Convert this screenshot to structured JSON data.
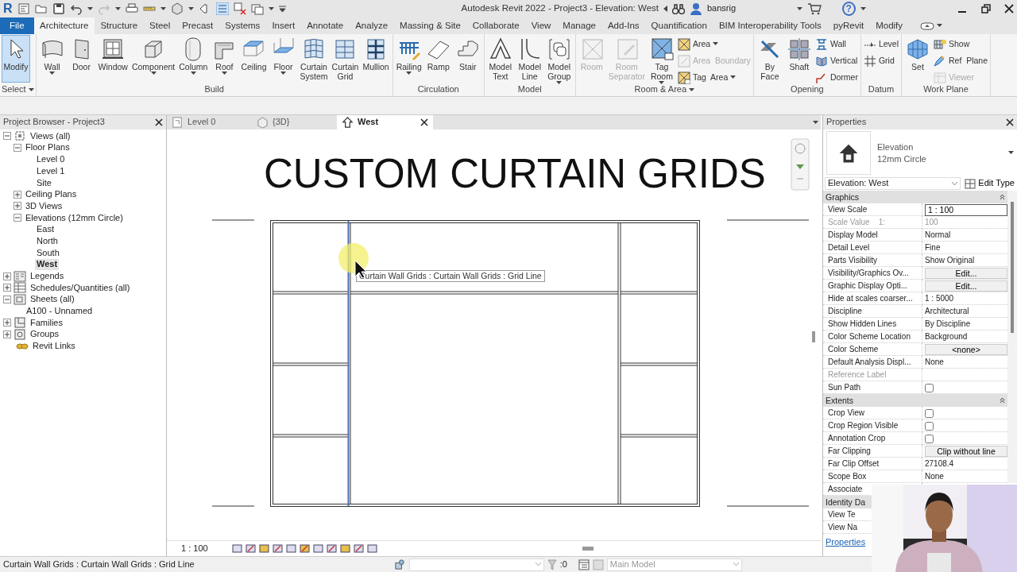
{
  "title_bar": {
    "logo": "R",
    "title": "Autodesk Revit 2022 - Project3 - Elevation: West",
    "user": "bansrig",
    "help": "?"
  },
  "ribbon_tabs": [
    {
      "label": "File",
      "kind": "file",
      "selected": false
    },
    {
      "label": "Architecture",
      "kind": "tab",
      "selected": true
    },
    {
      "label": "Structure",
      "kind": "tab",
      "selected": false
    },
    {
      "label": "Steel",
      "kind": "tab",
      "selected": false
    },
    {
      "label": "Precast",
      "kind": "tab",
      "selected": false
    },
    {
      "label": "Systems",
      "kind": "tab",
      "selected": false
    },
    {
      "label": "Insert",
      "kind": "tab",
      "selected": false
    },
    {
      "label": "Annotate",
      "kind": "tab",
      "selected": false
    },
    {
      "label": "Analyze",
      "kind": "tab",
      "selected": false
    },
    {
      "label": "Massing & Site",
      "kind": "tab",
      "selected": false
    },
    {
      "label": "Collaborate",
      "kind": "tab",
      "selected": false
    },
    {
      "label": "View",
      "kind": "tab",
      "selected": false
    },
    {
      "label": "Manage",
      "kind": "tab",
      "selected": false
    },
    {
      "label": "Add-Ins",
      "kind": "tab",
      "selected": false
    },
    {
      "label": "Quantification",
      "kind": "tab",
      "selected": false
    },
    {
      "label": "BIM Interoperability Tools",
      "kind": "tab",
      "selected": false
    },
    {
      "label": "pyRevit",
      "kind": "tab",
      "selected": false
    },
    {
      "label": "Modify",
      "kind": "tab",
      "selected": false
    }
  ],
  "ribbon_panels": [
    {
      "label": "Select",
      "menu": true,
      "tools": [
        {
          "label": "Modify",
          "kind": "large",
          "selected": true,
          "disabled": false,
          "dropdown": false
        }
      ]
    },
    {
      "label": "Build",
      "menu": false,
      "tools": [
        {
          "label": "Wall",
          "kind": "large",
          "selected": false,
          "disabled": false,
          "dropdown": true
        },
        {
          "label": "Door",
          "kind": "large",
          "selected": false,
          "disabled": false,
          "dropdown": false
        },
        {
          "label": "Window",
          "kind": "large",
          "selected": false,
          "disabled": false,
          "dropdown": false
        },
        {
          "label": "Component",
          "kind": "large",
          "selected": false,
          "disabled": false,
          "dropdown": true
        },
        {
          "label": "Column",
          "kind": "large",
          "selected": false,
          "disabled": false,
          "dropdown": true
        },
        {
          "label": "Roof",
          "kind": "large",
          "selected": false,
          "disabled": false,
          "dropdown": true
        },
        {
          "label": "Ceiling",
          "kind": "large",
          "selected": false,
          "disabled": false,
          "dropdown": false
        },
        {
          "label": "Floor",
          "kind": "large",
          "selected": false,
          "disabled": false,
          "dropdown": true
        },
        {
          "label": "Curtain\nSystem",
          "kind": "large",
          "selected": false,
          "disabled": false,
          "dropdown": false
        },
        {
          "label": "Curtain\nGrid",
          "kind": "large",
          "selected": false,
          "disabled": false,
          "dropdown": false
        },
        {
          "label": "Mullion",
          "kind": "large",
          "selected": false,
          "disabled": false,
          "dropdown": false
        }
      ]
    },
    {
      "label": "Circulation",
      "menu": false,
      "tools": [
        {
          "label": "Railing",
          "kind": "large",
          "selected": false,
          "disabled": false,
          "dropdown": true
        },
        {
          "label": "Ramp",
          "kind": "large",
          "selected": false,
          "disabled": false,
          "dropdown": false
        },
        {
          "label": "Stair",
          "kind": "large",
          "selected": false,
          "disabled": false,
          "dropdown": false
        }
      ]
    },
    {
      "label": "Model",
      "menu": false,
      "tools": [
        {
          "label": "Model\nText",
          "kind": "large",
          "selected": false,
          "disabled": false,
          "dropdown": false
        },
        {
          "label": "Model\nLine",
          "kind": "large",
          "selected": false,
          "disabled": false,
          "dropdown": false
        },
        {
          "label": "Model\nGroup",
          "kind": "large",
          "selected": false,
          "disabled": false,
          "dropdown": true
        }
      ]
    },
    {
      "label": "Room & Area",
      "menu": true,
      "tools": [
        {
          "label": "Room",
          "kind": "large",
          "selected": false,
          "disabled": true,
          "dropdown": false
        },
        {
          "label": "Room\nSeparator",
          "kind": "large",
          "selected": false,
          "disabled": true,
          "dropdown": false
        },
        {
          "label": "Tag\nRoom",
          "kind": "large",
          "selected": false,
          "disabled": false,
          "dropdown": true
        },
        {
          "label": "Area",
          "kind": "small",
          "selected": false,
          "disabled": false,
          "dropdown": true
        },
        {
          "label": "Area  Boundary",
          "kind": "small",
          "selected": false,
          "disabled": true,
          "dropdown": false
        },
        {
          "label": "Tag  Area",
          "kind": "small",
          "selected": false,
          "disabled": false,
          "dropdown": true
        }
      ]
    },
    {
      "label": "Opening",
      "menu": false,
      "tools": [
        {
          "label": "By\nFace",
          "kind": "large",
          "selected": false,
          "disabled": false,
          "dropdown": false
        },
        {
          "label": "Shaft",
          "kind": "large",
          "selected": false,
          "disabled": false,
          "dropdown": false
        },
        {
          "label": "Wall",
          "kind": "small",
          "selected": false,
          "disabled": false,
          "dropdown": false
        },
        {
          "label": "Vertical",
          "kind": "small",
          "selected": false,
          "disabled": false,
          "dropdown": false
        },
        {
          "label": "Dormer",
          "kind": "small",
          "selected": false,
          "disabled": false,
          "dropdown": false
        }
      ]
    },
    {
      "label": "Datum",
      "menu": false,
      "tools": [
        {
          "label": "Level",
          "kind": "small",
          "selected": false,
          "disabled": false,
          "dropdown": false
        },
        {
          "label": "Grid",
          "kind": "small",
          "selected": false,
          "disabled": false,
          "dropdown": false
        }
      ]
    },
    {
      "label": "Work Plane",
      "menu": false,
      "tools": [
        {
          "label": "Set",
          "kind": "large",
          "selected": false,
          "disabled": false,
          "dropdown": false
        },
        {
          "label": "Show",
          "kind": "small",
          "selected": false,
          "disabled": false,
          "dropdown": false
        },
        {
          "label": "Ref  Plane",
          "kind": "small",
          "selected": false,
          "disabled": false,
          "dropdown": false
        },
        {
          "label": "Viewer",
          "kind": "small",
          "selected": false,
          "disabled": true,
          "dropdown": false
        }
      ]
    }
  ],
  "browser": {
    "title": "Project Browser - Project3",
    "tree": [
      {
        "label": "Views (all)",
        "expanded": true,
        "selected": false,
        "children": [
          {
            "label": "Floor Plans",
            "expanded": true,
            "selected": false,
            "children": [
              {
                "label": "Level 0",
                "selected": false
              },
              {
                "label": "Level 1",
                "selected": false
              },
              {
                "label": "Site",
                "selected": false
              }
            ]
          },
          {
            "label": "Ceiling Plans",
            "expanded": false,
            "selected": false
          },
          {
            "label": "3D Views",
            "expanded": false,
            "selected": false
          },
          {
            "label": "Elevations (12mm Circle)",
            "expanded": true,
            "selected": false,
            "children": [
              {
                "label": "East",
                "selected": false
              },
              {
                "label": "North",
                "selected": false
              },
              {
                "label": "South",
                "selected": false
              },
              {
                "label": "West",
                "selected": true
              }
            ]
          }
        ]
      },
      {
        "label": "Legends",
        "expanded": false,
        "selected": false
      },
      {
        "label": "Schedules/Quantities (all)",
        "expanded": false,
        "selected": false
      },
      {
        "label": "Sheets (all)",
        "expanded": true,
        "selected": false,
        "children": [
          {
            "label": "A100 - Unnamed",
            "selected": false
          }
        ]
      },
      {
        "label": "Families",
        "expanded": false,
        "selected": false
      },
      {
        "label": "Groups",
        "expanded": false,
        "selected": false
      },
      {
        "label": "Revit Links",
        "selected": false
      }
    ]
  },
  "view_tabs": [
    {
      "label": "Level 0",
      "selected": false
    },
    {
      "label": "{3D}",
      "selected": false
    },
    {
      "label": "West",
      "selected": true
    }
  ],
  "canvas": {
    "title": "CUSTOM CURTAIN GRIDS",
    "tooltip": "Curtain Wall Grids : Curtain Wall Grids : Grid Line"
  },
  "view_control": {
    "scale": "1 : 100"
  },
  "properties": {
    "title": "Properties",
    "type_name": "Elevation",
    "type_sub": "12mm Circle",
    "instance": "Elevation: West",
    "edit_type": "Edit Type",
    "link": "Properties",
    "rows": [
      {
        "kind": "group",
        "label": "Graphics",
        "expanded": true
      },
      {
        "kind": "field",
        "name": "View Scale",
        "value": "1 : 100",
        "disabled": false
      },
      {
        "kind": "text",
        "name": "Scale Value    1:",
        "value": "100",
        "disabled": true
      },
      {
        "kind": "text",
        "name": "Display Model",
        "value": "Normal",
        "disabled": false
      },
      {
        "kind": "text",
        "name": "Detail Level",
        "value": "Fine",
        "disabled": false
      },
      {
        "kind": "text",
        "name": "Parts Visibility",
        "value": "Show Original",
        "disabled": false
      },
      {
        "kind": "button",
        "name": "Visibility/Graphics Ov...",
        "value": "Edit...",
        "disabled": false
      },
      {
        "kind": "button",
        "name": "Graphic Display Opti...",
        "value": "Edit...",
        "disabled": false
      },
      {
        "kind": "text",
        "name": "Hide at scales coarser...",
        "value": "1 : 5000",
        "disabled": false
      },
      {
        "kind": "text",
        "name": "Discipline",
        "value": "Architectural",
        "disabled": false
      },
      {
        "kind": "text",
        "name": "Show Hidden Lines",
        "value": "By Discipline",
        "disabled": false
      },
      {
        "kind": "text",
        "name": "Color Scheme Location",
        "value": "Background",
        "disabled": false
      },
      {
        "kind": "button",
        "name": "Color Scheme",
        "value": "<none>",
        "disabled": false
      },
      {
        "kind": "text",
        "name": "Default Analysis Displ...",
        "value": "None",
        "disabled": false
      },
      {
        "kind": "text",
        "name": "Reference Label",
        "disabled": true
      },
      {
        "kind": "checkbox",
        "name": "Sun Path",
        "checked": false,
        "disabled": false
      },
      {
        "kind": "group",
        "label": "Extents",
        "expanded": true
      },
      {
        "kind": "checkbox",
        "name": "Crop View",
        "checked": false,
        "disabled": false
      },
      {
        "kind": "checkbox",
        "name": "Crop Region Visible",
        "checked": false,
        "disabled": false
      },
      {
        "kind": "checkbox",
        "name": "Annotation Crop",
        "checked": false,
        "disabled": false
      },
      {
        "kind": "button",
        "name": "Far Clipping",
        "value": "Clip without line",
        "disabled": false
      },
      {
        "kind": "text",
        "name": "Far Clip Offset",
        "value": "27108.4",
        "disabled": false
      },
      {
        "kind": "text",
        "name": "Scope Box",
        "value": "None",
        "disabled": false
      },
      {
        "kind": "text",
        "name": "Associate",
        "disabled": false
      },
      {
        "kind": "group",
        "label": "Identity Da"
      },
      {
        "kind": "text",
        "name": "View Te",
        "disabled": false
      },
      {
        "kind": "text",
        "name": "View Na",
        "disabled": false
      }
    ]
  },
  "status_bar": {
    "text": "Curtain Wall Grids : Curtain Wall Grids : Grid Line",
    "filter_count": ":0",
    "model": "Main Model"
  }
}
